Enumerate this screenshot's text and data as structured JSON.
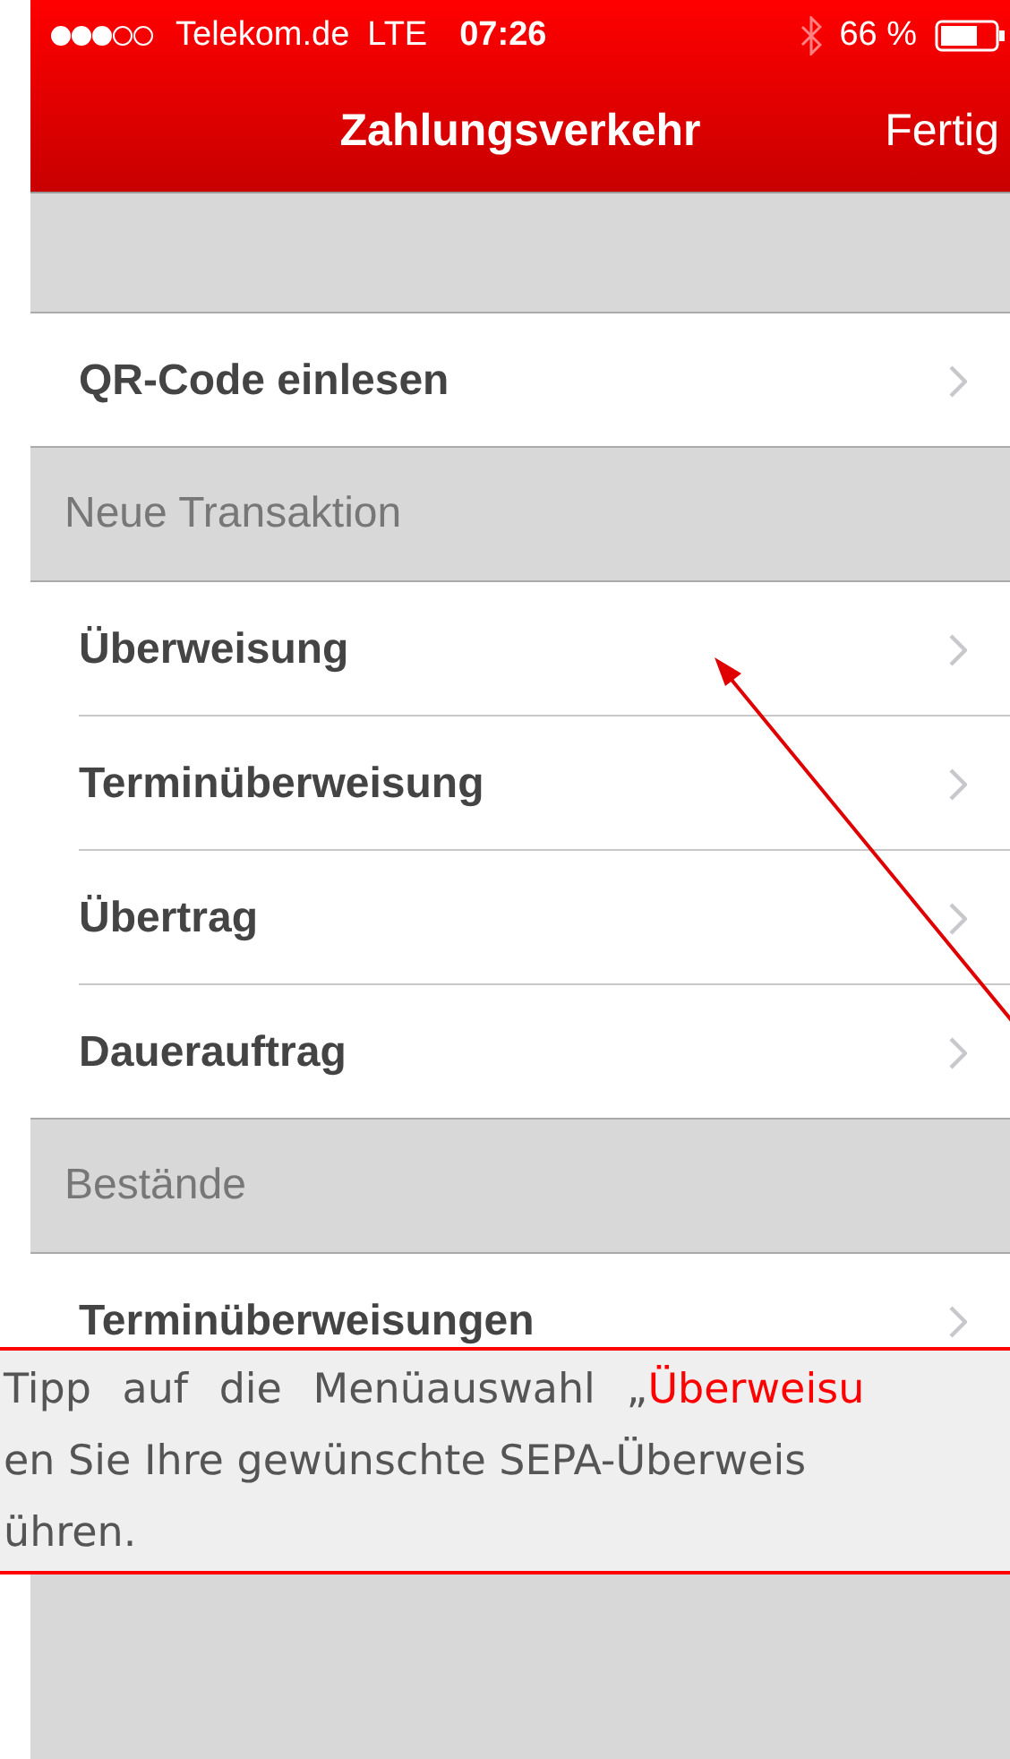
{
  "status_bar": {
    "carrier": "Telekom.de",
    "network": "LTE",
    "time": "07:26",
    "battery": "66 %"
  },
  "nav_bar": {
    "title": "Zahlungsverkehr",
    "done": "Fertig"
  },
  "sections": [
    {
      "items": [
        "QR-Code einlesen"
      ]
    },
    {
      "header": "Neue Transaktion",
      "items": [
        "Überweisung",
        "Terminüberweisung",
        "Übertrag",
        "Dauerauftrag"
      ]
    },
    {
      "header": "Bestände",
      "items": [
        "Terminüberweisungen"
      ]
    }
  ],
  "callout": {
    "lines": [
      [
        {
          "text": "Tipp auf die Menüauswahl „",
          "highlight": false
        },
        {
          "text": "Überweisu",
          "highlight": true
        }
      ],
      [
        {
          "text": "en Sie Ihre gewünschte SEPA-Überweis",
          "highlight": false
        }
      ],
      [
        {
          "text": "ühren.",
          "highlight": false
        }
      ]
    ]
  }
}
